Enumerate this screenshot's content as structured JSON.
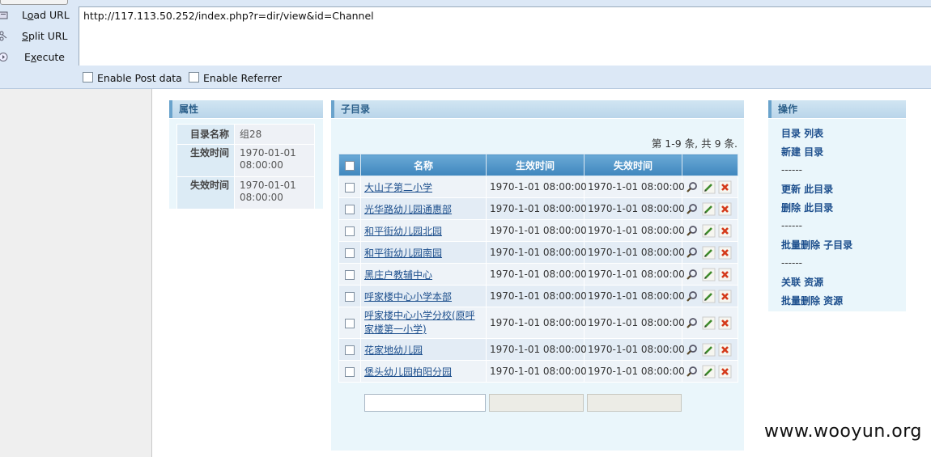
{
  "hackbar": {
    "load_url": "Load URL",
    "load_url_key": "o",
    "split_url": "Split URL",
    "split_url_key": "S",
    "execute": "Execute",
    "execute_key": "x",
    "url": "http://117.113.50.252/index.php?r=dir/view&id=Channel",
    "enable_post": "Enable Post data",
    "enable_referrer": "Enable Referrer"
  },
  "properties": {
    "title": "属性",
    "rows": [
      {
        "key": "目录名称",
        "value": "组28"
      },
      {
        "key": "生效时间",
        "value": "1970-01-01 08:00:00"
      },
      {
        "key": "失效时间",
        "value": "1970-01-01 08:00:00"
      }
    ]
  },
  "subdirs": {
    "title": "子目录",
    "count": "第 1-9 条, 共 9 条.",
    "columns": {
      "name": "名称",
      "start": "生效时间",
      "end": "失效时间"
    },
    "rows": [
      {
        "name": "大山子第二小学",
        "start": "1970-1-01 08:00:00",
        "end": "1970-1-01 08:00:00"
      },
      {
        "name": "光华路幼儿园通惠部",
        "start": "1970-1-01 08:00:00",
        "end": "1970-1-01 08:00:00"
      },
      {
        "name": "和平街幼儿园北园",
        "start": "1970-1-01 08:00:00",
        "end": "1970-1-01 08:00:00"
      },
      {
        "name": "和平街幼儿园南园",
        "start": "1970-1-01 08:00:00",
        "end": "1970-1-01 08:00:00"
      },
      {
        "name": "黑庄户教辅中心",
        "start": "1970-1-01 08:00:00",
        "end": "1970-1-01 08:00:00"
      },
      {
        "name": "呼家楼中心小学本部",
        "start": "1970-1-01 08:00:00",
        "end": "1970-1-01 08:00:00"
      },
      {
        "name": "呼家楼中心小学分校(原呼家楼第一小学)",
        "start": "1970-1-01 08:00:00",
        "end": "1970-1-01 08:00:00"
      },
      {
        "name": "花家地幼儿园",
        "start": "1970-1-01 08:00:00",
        "end": "1970-1-01 08:00:00"
      },
      {
        "name": "堡头幼儿园柏阳分园",
        "start": "1970-1-01 08:00:00",
        "end": "1970-1-01 08:00:00"
      }
    ]
  },
  "operations": {
    "title": "操作",
    "items": [
      {
        "type": "link",
        "label": "目录 列表"
      },
      {
        "type": "link",
        "label": "新建 目录"
      },
      {
        "type": "sep",
        "label": "------"
      },
      {
        "type": "link",
        "label": "更新 此目录"
      },
      {
        "type": "link",
        "label": "删除 此目录"
      },
      {
        "type": "sep",
        "label": "------"
      },
      {
        "type": "link",
        "label": "批量删除 子目录"
      },
      {
        "type": "sep",
        "label": "------"
      },
      {
        "type": "link",
        "label": "关联 资源"
      },
      {
        "type": "link",
        "label": "批量删除 资源"
      }
    ]
  },
  "watermark": "www.wooyun.org",
  "colors": {
    "accent": "#4a8fc3",
    "panel": "#eaf6fb",
    "link": "#1d4f8d"
  }
}
